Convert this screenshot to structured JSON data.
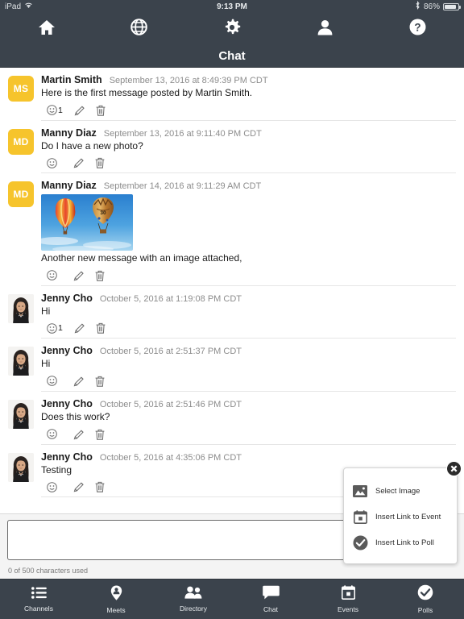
{
  "status_bar": {
    "device": "iPad",
    "wifi_icon": "wifi-icon",
    "time": "9:13 PM",
    "bluetooth_icon": "bluetooth-icon",
    "battery_percent": "86%",
    "battery_icon": "battery-icon"
  },
  "top_nav": {
    "items": [
      {
        "name": "home",
        "icon": "home-icon"
      },
      {
        "name": "globe",
        "icon": "globe-icon"
      },
      {
        "name": "settings",
        "icon": "gear-icon"
      },
      {
        "name": "profile",
        "icon": "person-icon"
      },
      {
        "name": "help",
        "icon": "question-circle-icon"
      }
    ]
  },
  "title_bar": {
    "title": "Chat"
  },
  "messages": [
    {
      "author": "Martin Smith",
      "timestamp": "September 13, 2016 at 8:49:39 PM CDT",
      "text": "Here is the first message posted by Martin Smith.",
      "avatar_type": "initials",
      "initials": "MS",
      "avatar_color": "#f6c42c",
      "reaction_count": "1",
      "has_image": false
    },
    {
      "author": "Manny Diaz",
      "timestamp": "September 13, 2016 at 9:11:40 PM CDT",
      "text": "Do I have a new photo?",
      "avatar_type": "initials",
      "initials": "MD",
      "avatar_color": "#f6c42c",
      "reaction_count": "",
      "has_image": false
    },
    {
      "author": "Manny Diaz",
      "timestamp": "September 14, 2016 at 9:11:29 AM CDT",
      "text": "Another new message with an image attached,",
      "avatar_type": "initials",
      "initials": "MD",
      "avatar_color": "#f6c42c",
      "reaction_count": "",
      "has_image": true,
      "image_alt": "hot-air-balloons-photo"
    },
    {
      "author": "Jenny Cho",
      "timestamp": "October 5, 2016 at 1:19:08 PM CDT",
      "text": "Hi",
      "avatar_type": "photo",
      "initials": "",
      "avatar_color": "",
      "reaction_count": "1",
      "has_image": false
    },
    {
      "author": "Jenny Cho",
      "timestamp": "October 5, 2016 at 2:51:37 PM CDT",
      "text": "Hi",
      "avatar_type": "photo",
      "initials": "",
      "avatar_color": "",
      "reaction_count": "",
      "has_image": false
    },
    {
      "author": "Jenny Cho",
      "timestamp": "October 5, 2016 at 2:51:46 PM CDT",
      "text": "Does this work?",
      "avatar_type": "photo",
      "initials": "",
      "avatar_color": "",
      "reaction_count": "",
      "has_image": false
    },
    {
      "author": "Jenny Cho",
      "timestamp": "October 5, 2016 at 4:35:06 PM CDT",
      "text": "Testing",
      "avatar_type": "photo",
      "initials": "",
      "avatar_color": "",
      "reaction_count": "",
      "has_image": false
    }
  ],
  "message_actions": {
    "react_icon": "smiley-icon",
    "edit_icon": "pencil-icon",
    "delete_icon": "trash-icon"
  },
  "composer": {
    "value": "",
    "placeholder": "",
    "char_count_label": "0 of 500 characters used"
  },
  "attach_popup": {
    "close_icon": "close-icon",
    "items": [
      {
        "label": "Select Image",
        "icon": "image-icon"
      },
      {
        "label": "Insert Link to Event",
        "icon": "calendar-icon"
      },
      {
        "label": "Insert Link to Poll",
        "icon": "check-circle-icon"
      }
    ]
  },
  "tab_bar": {
    "items": [
      {
        "label": "Channels",
        "icon": "list-icon"
      },
      {
        "label": "Meets",
        "icon": "map-pin-person-icon"
      },
      {
        "label": "Directory",
        "icon": "people-icon"
      },
      {
        "label": "Chat",
        "icon": "chat-bubble-icon"
      },
      {
        "label": "Events",
        "icon": "calendar-icon"
      },
      {
        "label": "Polls",
        "icon": "check-circle-icon"
      }
    ],
    "active": "Chat"
  },
  "colors": {
    "nav_background": "#3b434c",
    "avatar_yellow": "#f6c42c",
    "page_background": "#ffffff",
    "composer_background": "#f4f4f4"
  }
}
